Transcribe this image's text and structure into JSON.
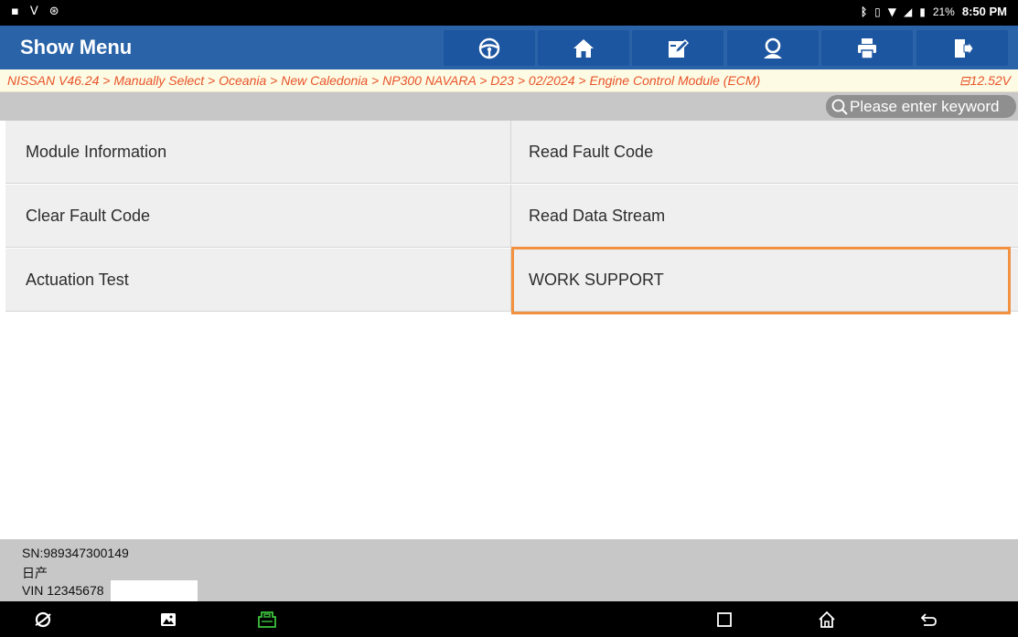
{
  "status_bar": {
    "left_icons": [
      "image-notification-icon",
      "usb-icon",
      "settings-notification-icon"
    ],
    "right_icons": [
      "bluetooth-icon",
      "vibrate-icon",
      "wifi-icon",
      "signal-icon"
    ],
    "battery": "21%",
    "time": "8:50 PM"
  },
  "header": {
    "title": "Show Menu",
    "toolbar": [
      "steering-wheel-icon",
      "home-icon",
      "edit-report-icon",
      "user-support-icon",
      "print-icon",
      "exit-icon"
    ]
  },
  "breadcrumb": {
    "path": "NISSAN V46.24 > Manually Select > Oceania > New Caledonia > NP300 NAVARA > D23 > 02/2024 > Engine Control Module (ECM)",
    "voltage": "⊟12.52V"
  },
  "search": {
    "placeholder": "Please enter keyword"
  },
  "menu": {
    "items": [
      {
        "label": "Module Information"
      },
      {
        "label": "Read Fault Code"
      },
      {
        "label": "Clear Fault Code"
      },
      {
        "label": "Read Data Stream"
      },
      {
        "label": "Actuation Test"
      },
      {
        "label": "WORK SUPPORT"
      }
    ]
  },
  "footer": {
    "sn": "SN:989347300149",
    "brand": "日产",
    "vin": "VIN 12345678"
  },
  "nav_bar": [
    "browser-icon",
    "gallery-icon",
    "vci-icon",
    "recents-icon",
    "home-icon",
    "back-icon"
  ],
  "colors": {
    "header_bg": "#2a63a8",
    "breadcrumb_text": "#e8532b",
    "highlight": "#f2913f",
    "vci_green": "#3cc43c"
  }
}
